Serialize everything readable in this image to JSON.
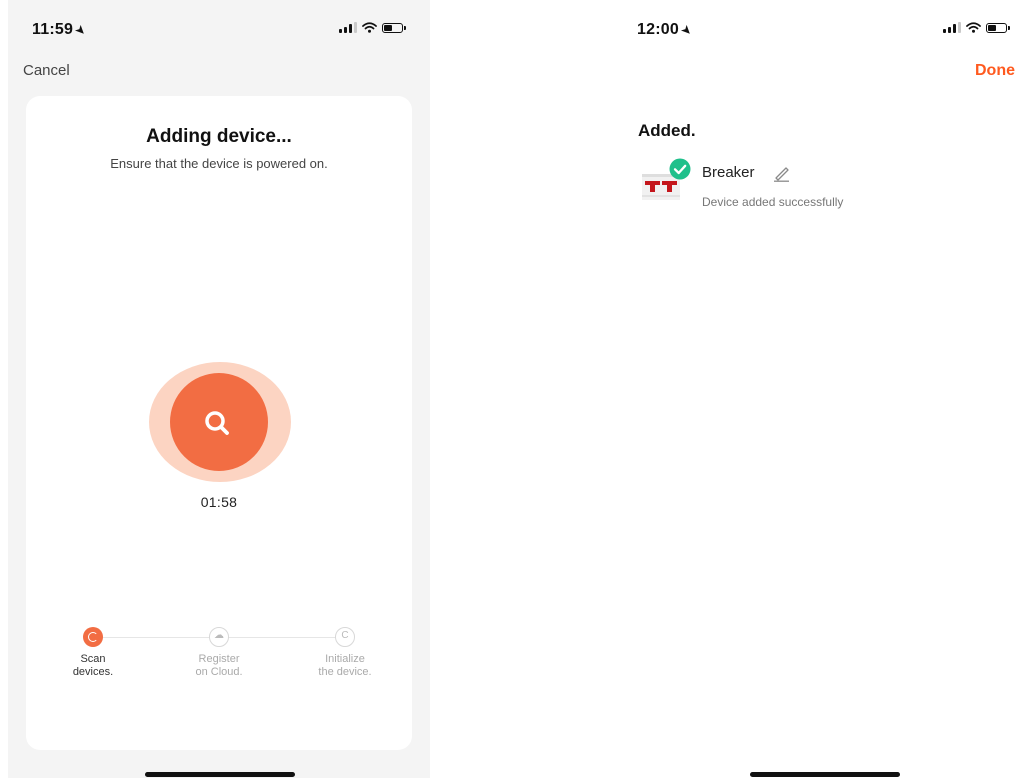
{
  "left_screen": {
    "status_time": "11:59",
    "cancel_label": "Cancel",
    "title": "Adding device...",
    "subtitle": "Ensure that the device is powered on.",
    "timer": "01:58",
    "steps": [
      {
        "label": "Scan\ndevices.",
        "state": "active",
        "icon": "refresh-icon"
      },
      {
        "label": "Register\non Cloud.",
        "state": "pending",
        "icon": "cloud-icon"
      },
      {
        "label": "Initialize\nthe device.",
        "state": "pending",
        "icon": "initialize-icon"
      }
    ]
  },
  "right_screen": {
    "status_time": "12:00",
    "done_label": "Done",
    "section_title": "Added.",
    "device": {
      "name": "Breaker",
      "status": "Device added successfully"
    }
  },
  "colors": {
    "accent": "#f26d43",
    "accent_light": "#fcd4c2",
    "done": "#ff5a1f",
    "success": "#1fc08b"
  }
}
